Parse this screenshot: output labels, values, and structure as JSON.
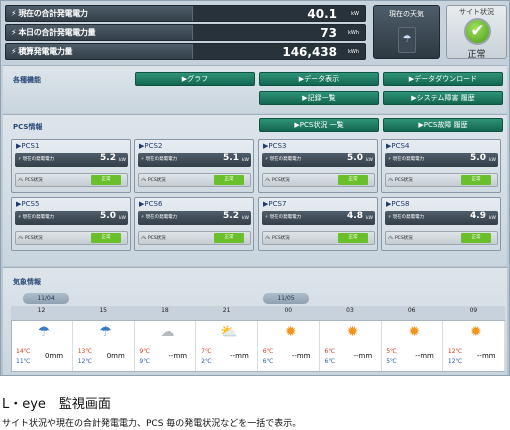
{
  "summary": [
    {
      "label": "現在の合計発電電力",
      "value": "40.1",
      "unit": "kW"
    },
    {
      "label": "本日の合計発電電力量",
      "value": "73",
      "unit": "kWh"
    },
    {
      "label": "積算発電電力量",
      "value": "146,438",
      "unit": "kWh"
    }
  ],
  "weather_now": {
    "title": "現在の天気"
  },
  "site_status": {
    "title": "サイト状況",
    "check": "✔",
    "state": "正常"
  },
  "functions": {
    "title": "各種機能",
    "buttons": [
      "▶グラフ",
      "▶データ表示",
      "▶データダウンロード",
      "▶記録一覧",
      "▶システム障害 履歴"
    ]
  },
  "pcs_info": {
    "title": "PCS情報",
    "buttons": [
      "▶PCS状況 一覧",
      "▶PCS故障 履歴"
    ],
    "power_label": "現在の発電電力",
    "status_label": "PCS状況",
    "unit": "kW",
    "units": [
      {
        "name": "PCS1",
        "value": "5.2",
        "status": "正常"
      },
      {
        "name": "PCS2",
        "value": "5.1",
        "status": "正常"
      },
      {
        "name": "PCS3",
        "value": "5.0",
        "status": "正常"
      },
      {
        "name": "PCS4",
        "value": "5.0",
        "status": "正常"
      },
      {
        "name": "PCS5",
        "value": "5.0",
        "status": "正常"
      },
      {
        "name": "PCS6",
        "value": "5.2",
        "status": "正常"
      },
      {
        "name": "PCS7",
        "value": "4.8",
        "status": "正常"
      },
      {
        "name": "PCS8",
        "value": "4.9",
        "status": "正常"
      }
    ]
  },
  "weather_info": {
    "title": "気象情報",
    "dates": [
      "11/04",
      "11/05"
    ],
    "slots": [
      {
        "time": "12",
        "icon": "rain-umbrella",
        "hi": "14℃",
        "lo": "11℃",
        "rain": "0mm"
      },
      {
        "time": "15",
        "icon": "rain-umbrella",
        "hi": "13℃",
        "lo": "12℃",
        "rain": "0mm"
      },
      {
        "time": "18",
        "icon": "cloud",
        "hi": "9℃",
        "lo": "9℃",
        "rain": "--mm"
      },
      {
        "time": "21",
        "icon": "sun-cloud",
        "hi": "7℃",
        "lo": "2℃",
        "rain": "--mm"
      },
      {
        "time": "00",
        "icon": "sun",
        "hi": "6℃",
        "lo": "6℃",
        "rain": "--mm"
      },
      {
        "time": "03",
        "icon": "sun",
        "hi": "6℃",
        "lo": "6℃",
        "rain": "--mm"
      },
      {
        "time": "06",
        "icon": "sun",
        "hi": "5℃",
        "lo": "5℃",
        "rain": "--mm"
      },
      {
        "time": "09",
        "icon": "sun",
        "hi": "12℃",
        "lo": "12℃",
        "rain": "--mm"
      }
    ]
  },
  "caption": {
    "title": "L・eye　監視画面",
    "subtitle": "サイト状況や現在の合計発電電力、PCS 毎の発電状況などを一括で表示。"
  }
}
